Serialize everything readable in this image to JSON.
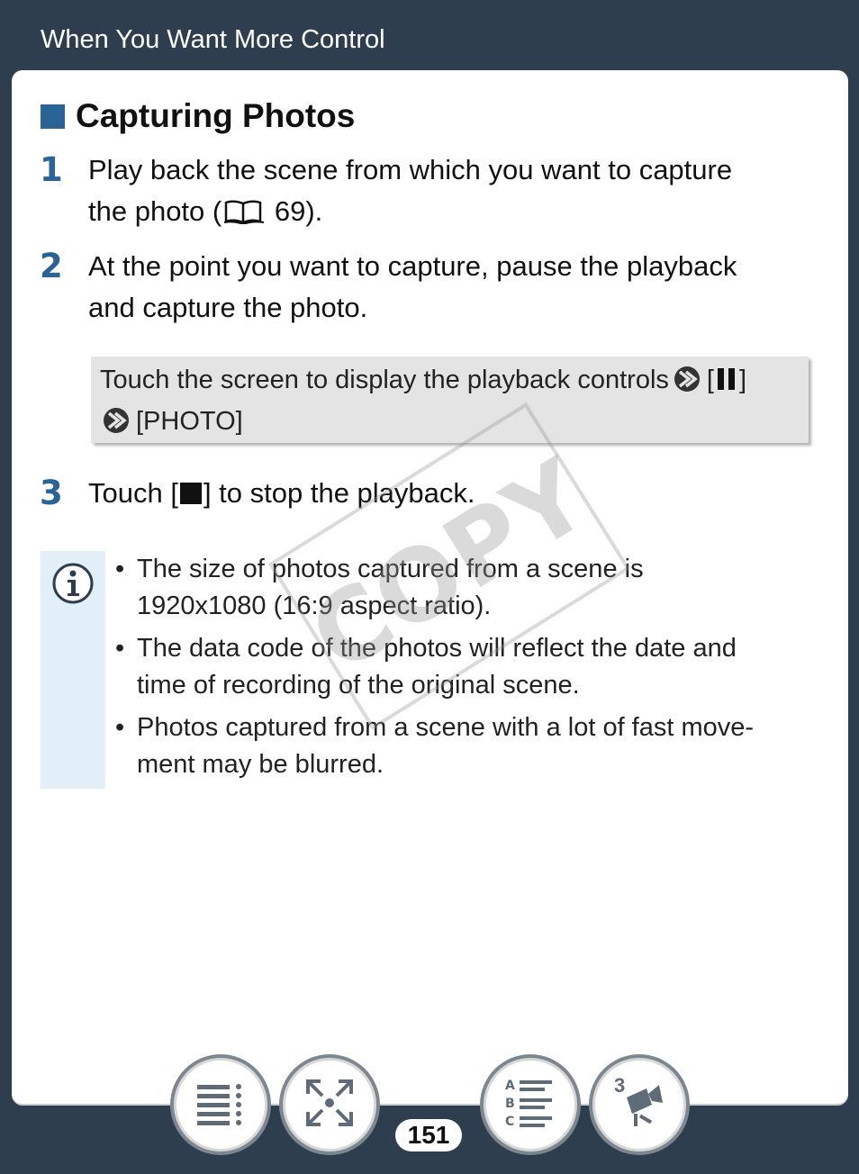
{
  "header": {
    "title": "When You Want More Control"
  },
  "section": {
    "title": "Capturing Photos"
  },
  "steps": [
    {
      "number": "1",
      "text_a": "Play back the scene from which you want to capture",
      "text_b": "the photo (",
      "ref": "69)."
    },
    {
      "number": "2",
      "text_a": "At the point you want to capture, pause the playback",
      "text_b": "and capture the photo."
    },
    {
      "number": "3",
      "text_pre": "Touch [",
      "text_post": "] to stop the playback."
    }
  ],
  "instruction": {
    "line1": "Touch the screen to display the playback controls",
    "pause_open": "[",
    "pause_close": "]",
    "line2": "[PHOTO]"
  },
  "notes": [
    {
      "line1": "The size of photos captured from a scene is",
      "line2": "1920x1080 (16:9 aspect ratio)."
    },
    {
      "line1": "The data code of the photos will reflect the date and",
      "line2": "time of recording of the original scene."
    },
    {
      "line1": "Photos captured from a scene with a lot of fast move-",
      "line2": "ment may be blurred."
    }
  ],
  "watermark": "COPY",
  "page_number": "151",
  "nav": {
    "scenes_badge": "3"
  },
  "icons": [
    "book-icon",
    "arrow-icon",
    "pause-icon",
    "stop-icon",
    "info-icon",
    "contents-icon",
    "fit-screen-icon",
    "index-icon",
    "camcorder-icon"
  ],
  "colors": {
    "background": "#2e3e4f",
    "accent": "#2a6496",
    "note_bar": "#e3eff8",
    "instruction_box": "#e4e4e4"
  }
}
